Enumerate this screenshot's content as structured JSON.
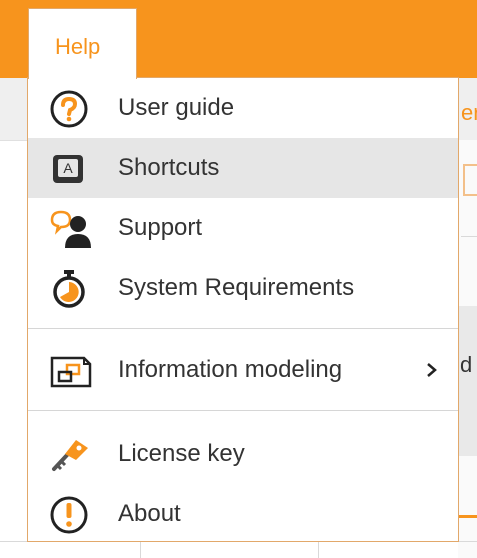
{
  "menubar": {
    "help_label": "Help",
    "accent_color": "#f7941d"
  },
  "background": {
    "partial_text_top": "er",
    "partial_text_mid": "d"
  },
  "help_menu": {
    "items": [
      {
        "label": "User guide",
        "icon": "question-circle-icon"
      },
      {
        "label": "Shortcuts",
        "icon": "keyboard-key-icon",
        "highlighted": true
      },
      {
        "label": "Support",
        "icon": "support-person-icon"
      },
      {
        "label": "System Requirements",
        "icon": "stopwatch-icon"
      },
      {
        "label": "Information modeling",
        "icon": "modeling-icon",
        "has_submenu": true
      },
      {
        "label": "License key",
        "icon": "key-icon"
      },
      {
        "label": "About",
        "icon": "exclamation-circle-icon"
      }
    ]
  }
}
